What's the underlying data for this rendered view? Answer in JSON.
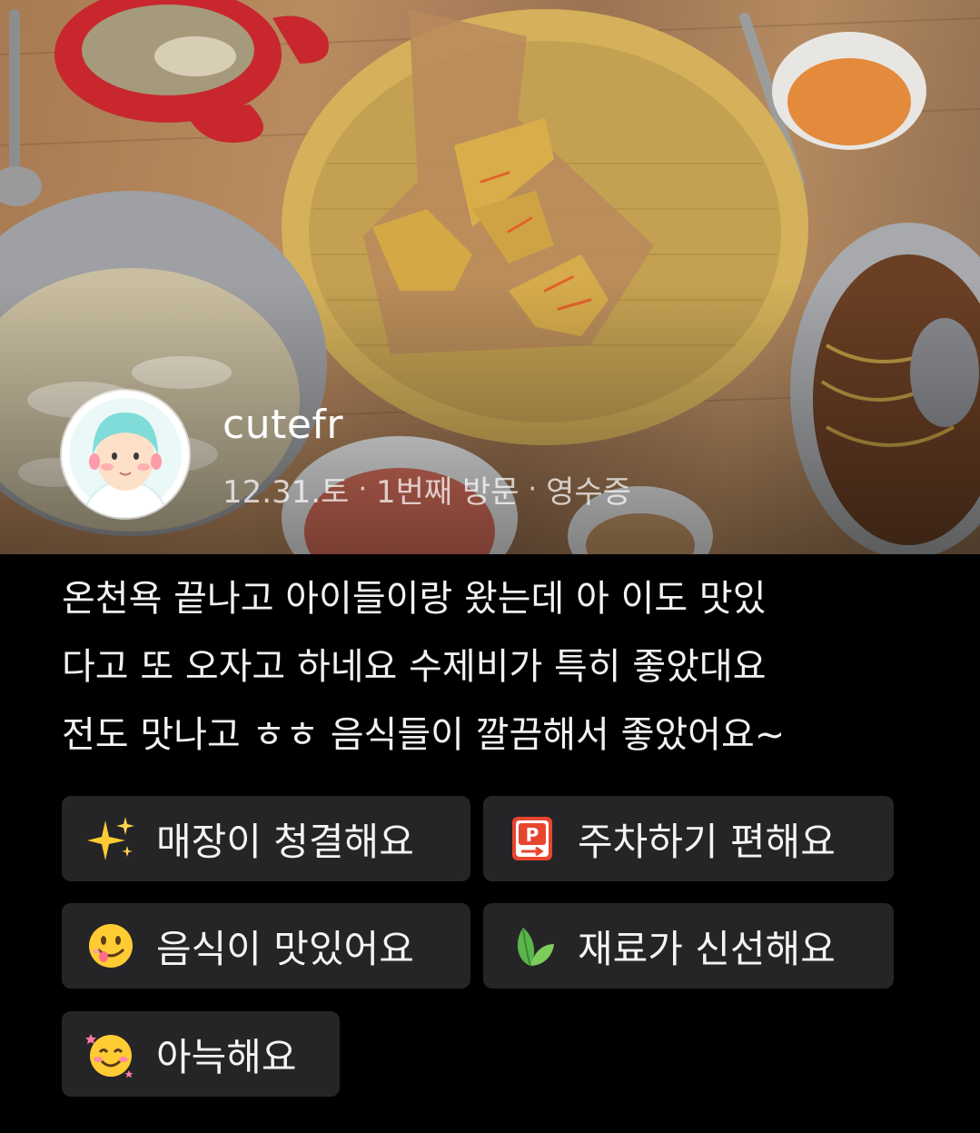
{
  "profile": {
    "username": "cutefr",
    "date": "12.31.토",
    "visit": "1번째 방문",
    "receipt": "영수증",
    "separator": "·"
  },
  "review": {
    "lines": [
      "온천욕 끝나고 아이들이랑 왔는데 아 이도 맛있",
      "다고 또 오자고 하네요 수제비가 특히 좋았대요",
      "전도 맛나고 ㅎㅎ 음식들이 깔끔해서 좋았어요~"
    ]
  },
  "keywords": [
    {
      "label": "매장이 청결해요",
      "icon": "sparkles-icon"
    },
    {
      "label": "주차하기 편해요",
      "icon": "parking-icon"
    },
    {
      "label": "음식이 맛있어요",
      "icon": "yum-face-icon"
    },
    {
      "label": "재료가 신선해요",
      "icon": "leaf-icon"
    },
    {
      "label": "아늑해요",
      "icon": "smiling-blush-icon"
    }
  ],
  "colors": {
    "background": "#000000",
    "chip_background": "#252528",
    "text": "#ffffff",
    "meta_text": "#b8b8b8",
    "avatar_hair": "#7fdcd8"
  }
}
